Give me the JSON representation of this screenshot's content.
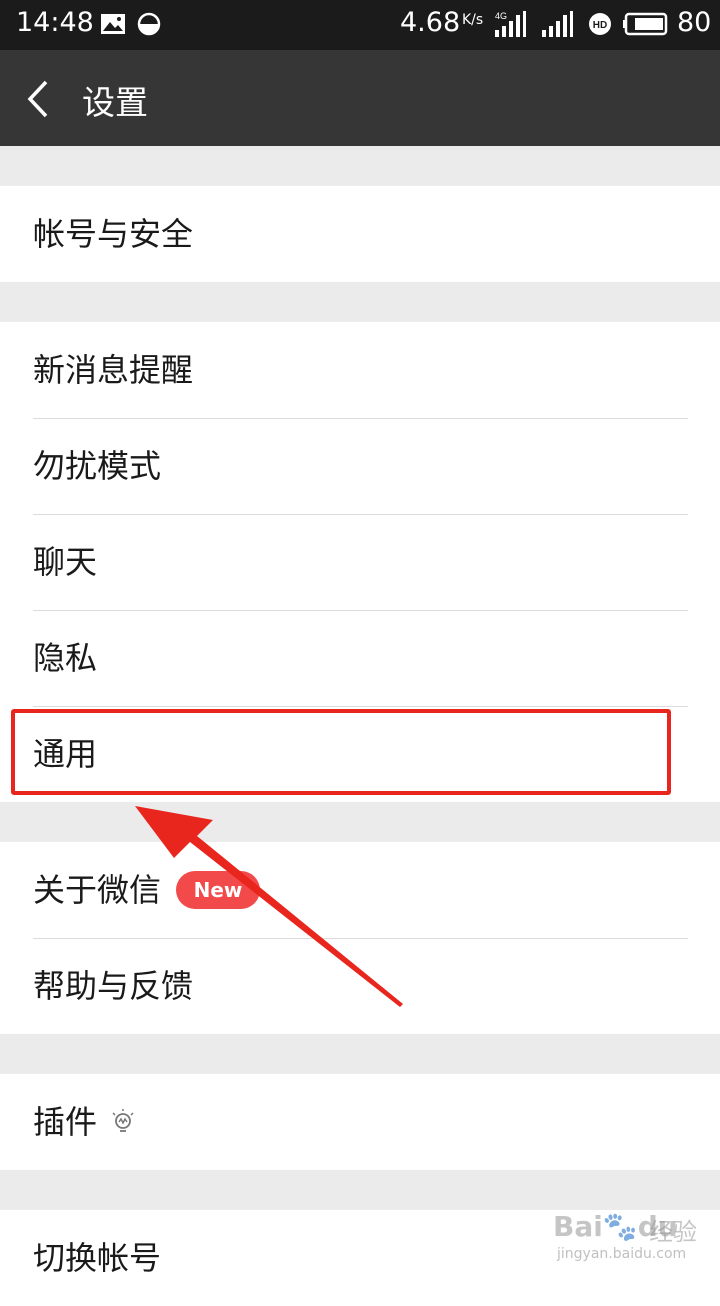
{
  "status_bar": {
    "time": "14:48",
    "net_speed": "4.68",
    "net_unit": "K/s",
    "network_label": "4G",
    "battery_percent": "80",
    "icons": [
      "image-icon",
      "half-circle-icon",
      "signal-4g-icon",
      "signal-icon",
      "hd-icon",
      "battery-icon"
    ]
  },
  "header": {
    "title": "设置",
    "back_icon": "chevron-left-icon"
  },
  "settings": {
    "group1": [
      {
        "label": "帐号与安全"
      }
    ],
    "group2": [
      {
        "label": "新消息提醒"
      },
      {
        "label": "勿扰模式"
      },
      {
        "label": "聊天"
      },
      {
        "label": "隐私"
      },
      {
        "label": "通用"
      }
    ],
    "group3": [
      {
        "label": "关于微信",
        "badge": "New"
      },
      {
        "label": "帮助与反馈"
      }
    ],
    "group4": [
      {
        "label": "插件",
        "icon": "lightbulb-icon"
      }
    ],
    "group5": [
      {
        "label": "切换帐号"
      }
    ]
  },
  "annotation": {
    "highlight_color": "#e8261e",
    "highlighted_item": "通用"
  },
  "watermark": {
    "brand": "Bai",
    "brand_tail": "du",
    "product": "经验",
    "url": "jingyan.baidu.com"
  },
  "colors": {
    "status_bg": "#1b1b1b",
    "header_bg": "#363636",
    "page_bg": "#ebebeb",
    "badge": "#f24a4a"
  }
}
